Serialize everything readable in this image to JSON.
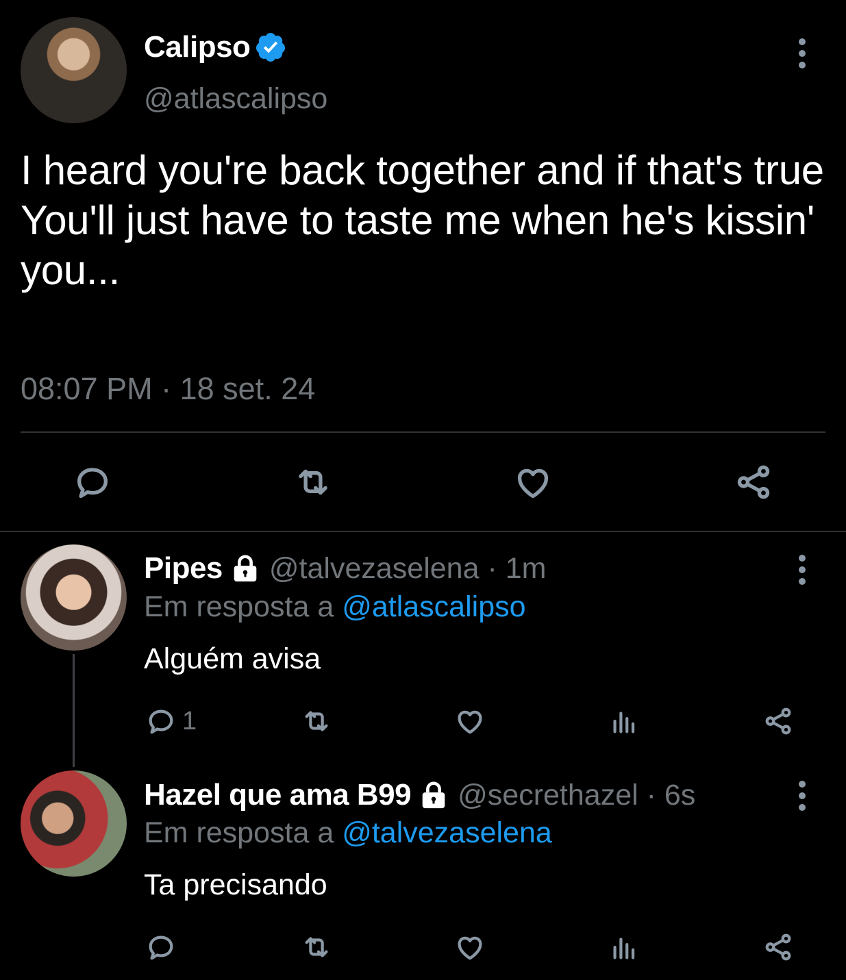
{
  "colors": {
    "background": "#000000",
    "text": "#ffffff",
    "muted": "#71767b",
    "accent": "#1d9bf0",
    "divider": "#2f3336"
  },
  "main_tweet": {
    "name": "Calipso",
    "verified_icon": "verified-badge-icon",
    "handle": "@atlascalipso",
    "text": "I heard you're back together and if that's true\nYou'll just have to taste me when he's kissin' you...",
    "timestamp": "08:07 PM · 18 set. 24",
    "actions": [
      "reply-icon",
      "retweet-icon",
      "like-icon",
      "share-icon"
    ]
  },
  "replies": [
    {
      "name": "Pipes",
      "handle": "@talvezaselena",
      "age": "1m",
      "reply_label": "Em resposta a ",
      "reply_mention": "@atlascalipso",
      "text": "Alguém avisa",
      "reply_count": "1"
    },
    {
      "name": "Hazel que ama B99",
      "handle": "@secrethazel",
      "age": "6s",
      "reply_label": "Em resposta a ",
      "reply_mention": "@talvezaselena",
      "text": "Ta precisando",
      "reply_count": ""
    }
  ]
}
